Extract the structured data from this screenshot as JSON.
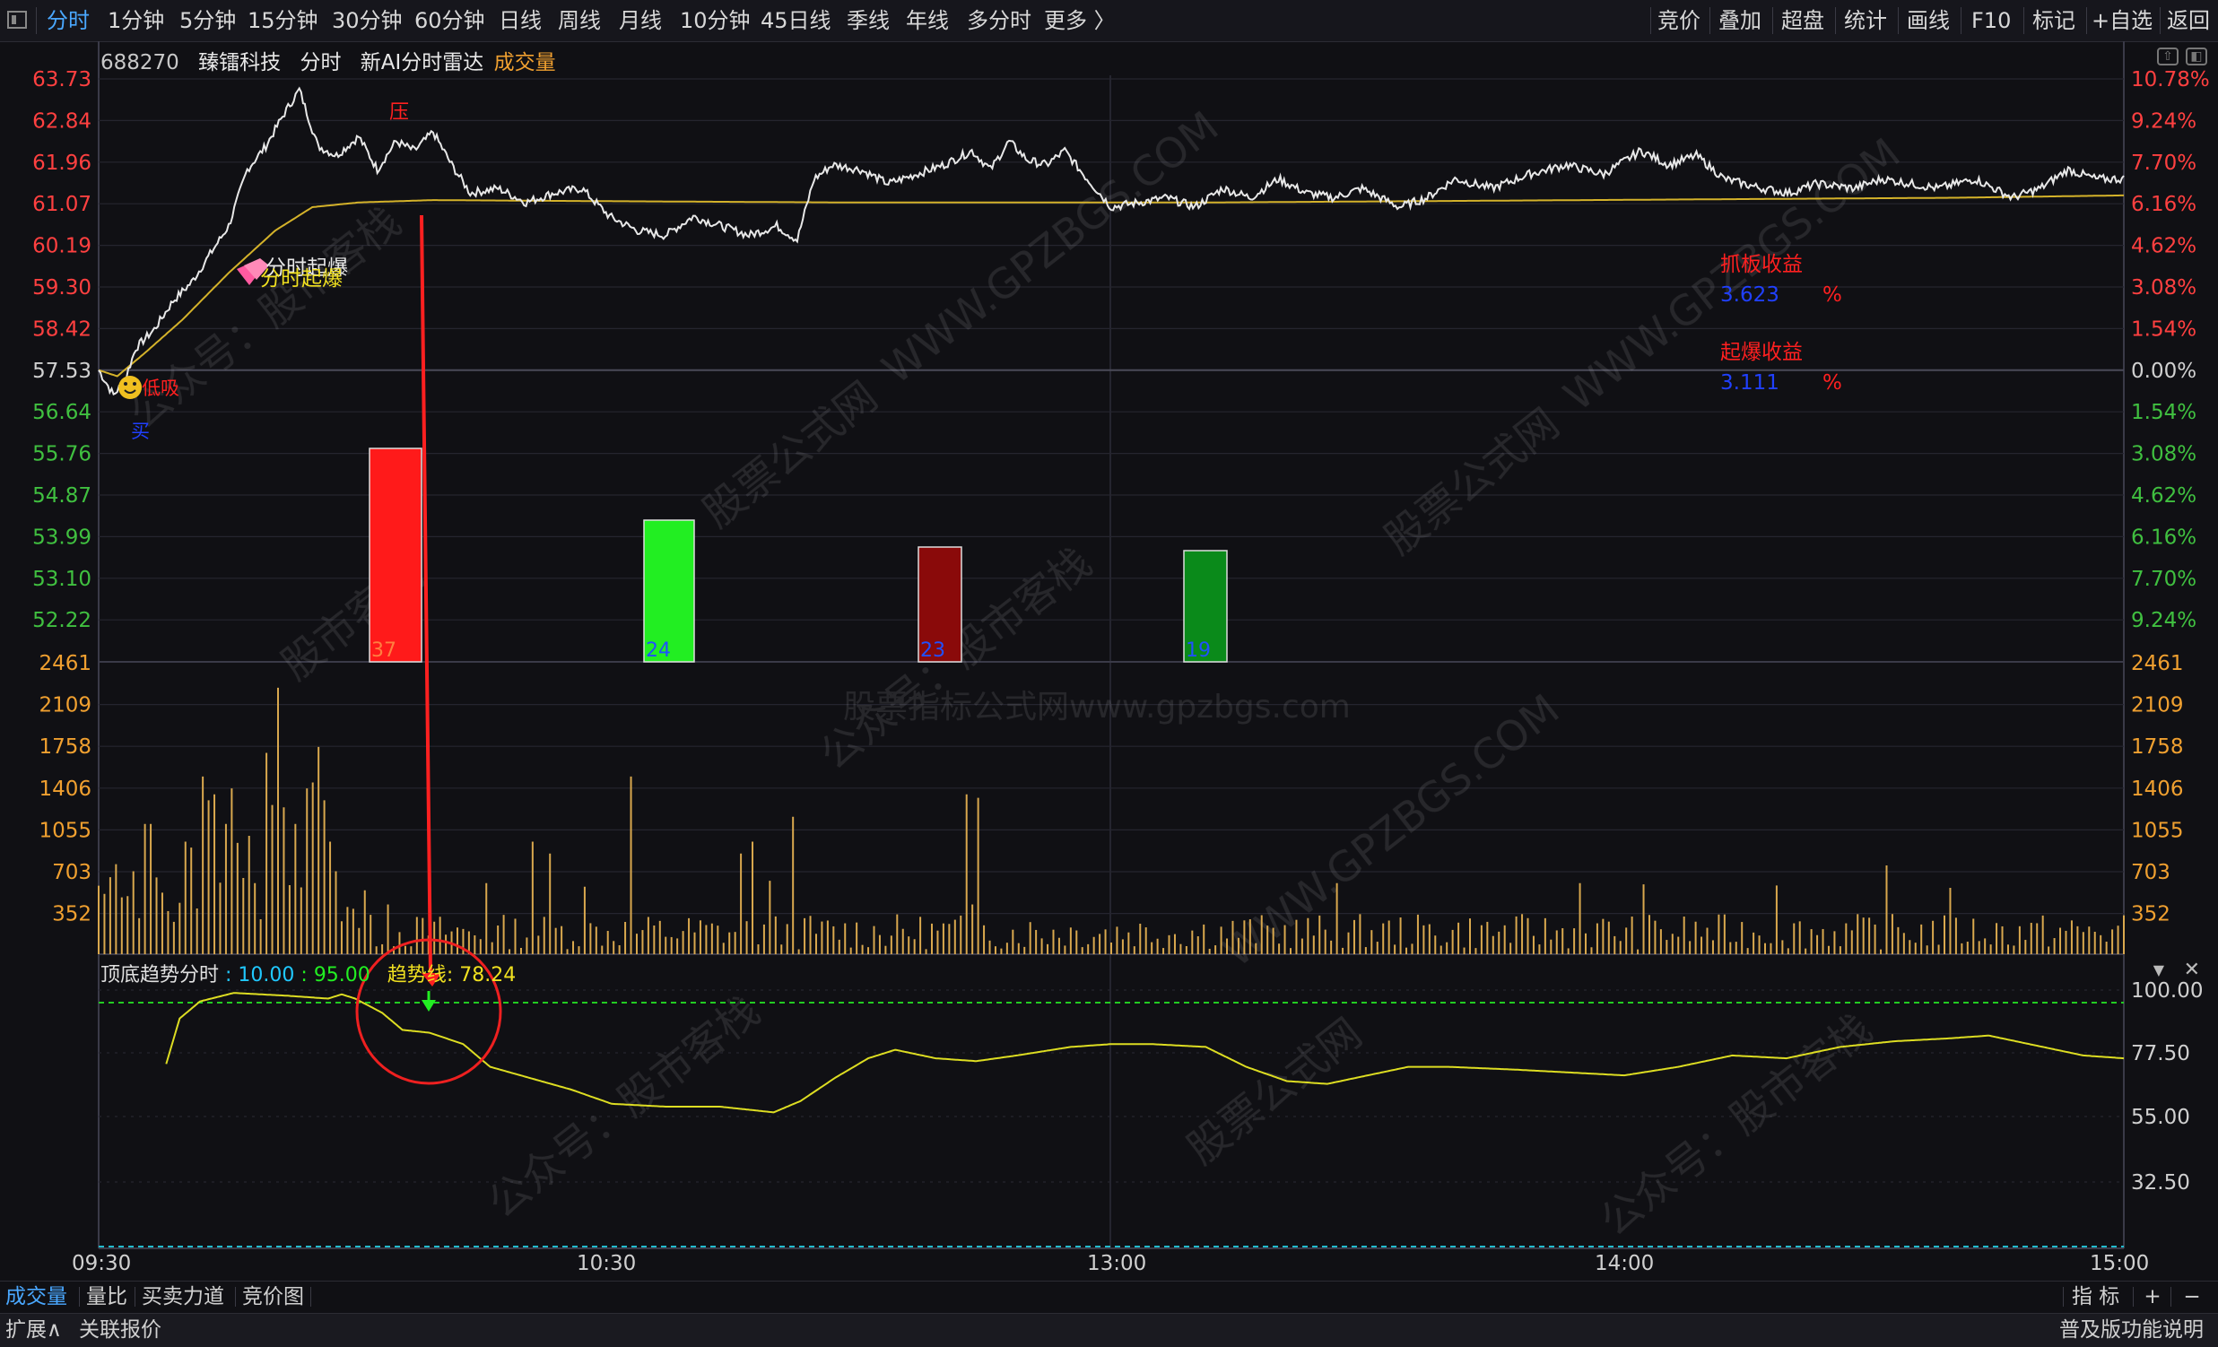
{
  "toolbar": {
    "periods": [
      "分时",
      "1分钟",
      "5分钟",
      "15分钟",
      "30分钟",
      "60分钟",
      "日线",
      "周线",
      "月线",
      "10分钟",
      "45日线",
      "季线",
      "年线",
      "多分时",
      "更多 〉"
    ],
    "active": "分时",
    "right_buttons": [
      "竞价",
      "叠加",
      "超盘",
      "统计",
      "画线",
      "F10",
      "标记",
      "+自选",
      "返回"
    ]
  },
  "stock": {
    "code": "688270",
    "name": "臻镭科技",
    "period_label": "分时",
    "indicator_name": "新AI分时雷达",
    "volume_label": "成交量"
  },
  "price_axis": {
    "left": [
      "63.73",
      "62.84",
      "61.96",
      "61.07",
      "60.19",
      "59.30",
      "58.42",
      "57.53",
      "56.64",
      "55.76",
      "54.87",
      "53.99",
      "53.10",
      "52.22"
    ],
    "right": [
      "10.78%",
      "9.24%",
      "7.70%",
      "6.16%",
      "4.62%",
      "3.08%",
      "1.54%",
      "0.00%",
      "1.54%",
      "3.08%",
      "4.62%",
      "6.16%",
      "7.70%",
      "9.24%"
    ]
  },
  "volume_axis": {
    "left": [
      "2461",
      "2109",
      "1758",
      "1406",
      "1055",
      "703",
      "352"
    ],
    "right": [
      "2461",
      "2109",
      "1758",
      "1406",
      "1055",
      "703",
      "352"
    ]
  },
  "annotations": {
    "top_marker": "压",
    "breakout_label_1": "分时起爆",
    "breakout_label_2": "分时起爆",
    "buy_label": "低吸",
    "buy_sub": "买",
    "grab_profit_label": "抓板收益",
    "grab_profit_value": "3.623",
    "grab_profit_unit": "%",
    "burst_profit_label": "起爆收益",
    "burst_profit_value": "3.111",
    "burst_profit_unit": "%"
  },
  "bars": [
    {
      "value": "37",
      "color": "#ff1a1a",
      "label_color": "#ff7f40"
    },
    {
      "value": "24",
      "color": "#22ee22",
      "label_color": "#2050ff"
    },
    {
      "value": "23",
      "color": "#8a0a0a",
      "label_color": "#2050ff"
    },
    {
      "value": "19",
      "color": "#0a8a1a",
      "label_color": "#2050ff"
    }
  ],
  "indicator": {
    "name": "顶底趋势分时",
    "param1": "10.00",
    "param2": "95.00",
    "line_label": "趋势线",
    "line_value": "78.24",
    "axis": [
      "100.00",
      "77.50",
      "55.00",
      "32.50"
    ]
  },
  "time_axis": [
    "09:30",
    "10:30",
    "13:00",
    "14:00",
    "15:00"
  ],
  "watermarks": [
    "股票指标公式网www.gpzbgs.com",
    "WWW.GPZBGS.COM",
    "公众号：股市客栈",
    "股市客栈",
    "股票公式网"
  ],
  "bottom_tabs": [
    "成交量",
    "量比",
    "买卖力道",
    "竞价图"
  ],
  "bottom_right": [
    "指 标",
    "+",
    "−"
  ],
  "status": {
    "left": [
      "扩展∧",
      "关联报价"
    ],
    "right": "普及版功能说明"
  },
  "colors": {
    "price_line": "#e8e8e8",
    "avg_line": "#d4b22a",
    "volume_bar": "#d9a84e",
    "indicator_line": "#dddd22",
    "up_text": "#ff4040",
    "down_text": "#40c040",
    "accent": "#4aa8ff"
  }
}
